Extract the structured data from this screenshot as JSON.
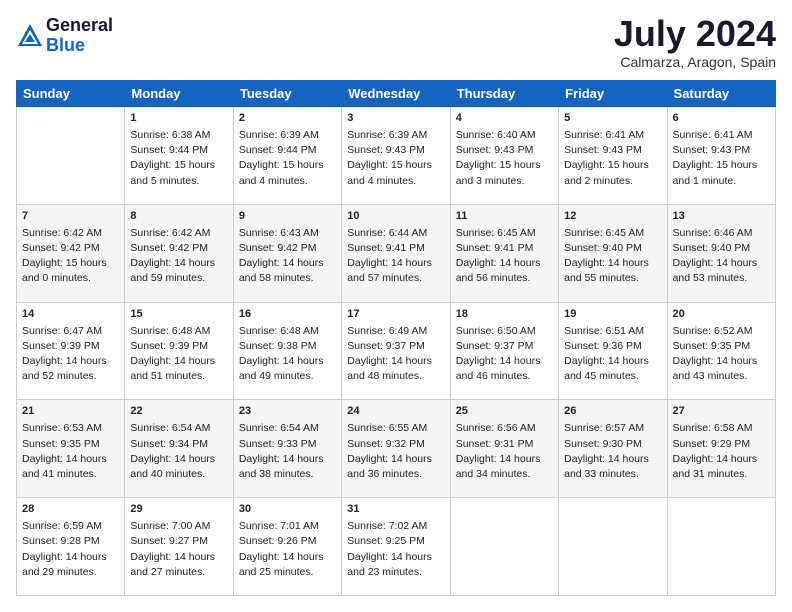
{
  "header": {
    "logo_general": "General",
    "logo_blue": "Blue",
    "month_title": "July 2024",
    "location": "Calmarza, Aragon, Spain"
  },
  "weekdays": [
    "Sunday",
    "Monday",
    "Tuesday",
    "Wednesday",
    "Thursday",
    "Friday",
    "Saturday"
  ],
  "weeks": [
    [
      {
        "day": "",
        "sunrise": "",
        "sunset": "",
        "daylight": ""
      },
      {
        "day": "1",
        "sunrise": "Sunrise: 6:38 AM",
        "sunset": "Sunset: 9:44 PM",
        "daylight": "Daylight: 15 hours and 5 minutes."
      },
      {
        "day": "2",
        "sunrise": "Sunrise: 6:39 AM",
        "sunset": "Sunset: 9:44 PM",
        "daylight": "Daylight: 15 hours and 4 minutes."
      },
      {
        "day": "3",
        "sunrise": "Sunrise: 6:39 AM",
        "sunset": "Sunset: 9:43 PM",
        "daylight": "Daylight: 15 hours and 4 minutes."
      },
      {
        "day": "4",
        "sunrise": "Sunrise: 6:40 AM",
        "sunset": "Sunset: 9:43 PM",
        "daylight": "Daylight: 15 hours and 3 minutes."
      },
      {
        "day": "5",
        "sunrise": "Sunrise: 6:41 AM",
        "sunset": "Sunset: 9:43 PM",
        "daylight": "Daylight: 15 hours and 2 minutes."
      },
      {
        "day": "6",
        "sunrise": "Sunrise: 6:41 AM",
        "sunset": "Sunset: 9:43 PM",
        "daylight": "Daylight: 15 hours and 1 minute."
      }
    ],
    [
      {
        "day": "7",
        "sunrise": "Sunrise: 6:42 AM",
        "sunset": "Sunset: 9:42 PM",
        "daylight": "Daylight: 15 hours and 0 minutes."
      },
      {
        "day": "8",
        "sunrise": "Sunrise: 6:42 AM",
        "sunset": "Sunset: 9:42 PM",
        "daylight": "Daylight: 14 hours and 59 minutes."
      },
      {
        "day": "9",
        "sunrise": "Sunrise: 6:43 AM",
        "sunset": "Sunset: 9:42 PM",
        "daylight": "Daylight: 14 hours and 58 minutes."
      },
      {
        "day": "10",
        "sunrise": "Sunrise: 6:44 AM",
        "sunset": "Sunset: 9:41 PM",
        "daylight": "Daylight: 14 hours and 57 minutes."
      },
      {
        "day": "11",
        "sunrise": "Sunrise: 6:45 AM",
        "sunset": "Sunset: 9:41 PM",
        "daylight": "Daylight: 14 hours and 56 minutes."
      },
      {
        "day": "12",
        "sunrise": "Sunrise: 6:45 AM",
        "sunset": "Sunset: 9:40 PM",
        "daylight": "Daylight: 14 hours and 55 minutes."
      },
      {
        "day": "13",
        "sunrise": "Sunrise: 6:46 AM",
        "sunset": "Sunset: 9:40 PM",
        "daylight": "Daylight: 14 hours and 53 minutes."
      }
    ],
    [
      {
        "day": "14",
        "sunrise": "Sunrise: 6:47 AM",
        "sunset": "Sunset: 9:39 PM",
        "daylight": "Daylight: 14 hours and 52 minutes."
      },
      {
        "day": "15",
        "sunrise": "Sunrise: 6:48 AM",
        "sunset": "Sunset: 9:39 PM",
        "daylight": "Daylight: 14 hours and 51 minutes."
      },
      {
        "day": "16",
        "sunrise": "Sunrise: 6:48 AM",
        "sunset": "Sunset: 9:38 PM",
        "daylight": "Daylight: 14 hours and 49 minutes."
      },
      {
        "day": "17",
        "sunrise": "Sunrise: 6:49 AM",
        "sunset": "Sunset: 9:37 PM",
        "daylight": "Daylight: 14 hours and 48 minutes."
      },
      {
        "day": "18",
        "sunrise": "Sunrise: 6:50 AM",
        "sunset": "Sunset: 9:37 PM",
        "daylight": "Daylight: 14 hours and 46 minutes."
      },
      {
        "day": "19",
        "sunrise": "Sunrise: 6:51 AM",
        "sunset": "Sunset: 9:36 PM",
        "daylight": "Daylight: 14 hours and 45 minutes."
      },
      {
        "day": "20",
        "sunrise": "Sunrise: 6:52 AM",
        "sunset": "Sunset: 9:35 PM",
        "daylight": "Daylight: 14 hours and 43 minutes."
      }
    ],
    [
      {
        "day": "21",
        "sunrise": "Sunrise: 6:53 AM",
        "sunset": "Sunset: 9:35 PM",
        "daylight": "Daylight: 14 hours and 41 minutes."
      },
      {
        "day": "22",
        "sunrise": "Sunrise: 6:54 AM",
        "sunset": "Sunset: 9:34 PM",
        "daylight": "Daylight: 14 hours and 40 minutes."
      },
      {
        "day": "23",
        "sunrise": "Sunrise: 6:54 AM",
        "sunset": "Sunset: 9:33 PM",
        "daylight": "Daylight: 14 hours and 38 minutes."
      },
      {
        "day": "24",
        "sunrise": "Sunrise: 6:55 AM",
        "sunset": "Sunset: 9:32 PM",
        "daylight": "Daylight: 14 hours and 36 minutes."
      },
      {
        "day": "25",
        "sunrise": "Sunrise: 6:56 AM",
        "sunset": "Sunset: 9:31 PM",
        "daylight": "Daylight: 14 hours and 34 minutes."
      },
      {
        "day": "26",
        "sunrise": "Sunrise: 6:57 AM",
        "sunset": "Sunset: 9:30 PM",
        "daylight": "Daylight: 14 hours and 33 minutes."
      },
      {
        "day": "27",
        "sunrise": "Sunrise: 6:58 AM",
        "sunset": "Sunset: 9:29 PM",
        "daylight": "Daylight: 14 hours and 31 minutes."
      }
    ],
    [
      {
        "day": "28",
        "sunrise": "Sunrise: 6:59 AM",
        "sunset": "Sunset: 9:28 PM",
        "daylight": "Daylight: 14 hours and 29 minutes."
      },
      {
        "day": "29",
        "sunrise": "Sunrise: 7:00 AM",
        "sunset": "Sunset: 9:27 PM",
        "daylight": "Daylight: 14 hours and 27 minutes."
      },
      {
        "day": "30",
        "sunrise": "Sunrise: 7:01 AM",
        "sunset": "Sunset: 9:26 PM",
        "daylight": "Daylight: 14 hours and 25 minutes."
      },
      {
        "day": "31",
        "sunrise": "Sunrise: 7:02 AM",
        "sunset": "Sunset: 9:25 PM",
        "daylight": "Daylight: 14 hours and 23 minutes."
      },
      {
        "day": "",
        "sunrise": "",
        "sunset": "",
        "daylight": ""
      },
      {
        "day": "",
        "sunrise": "",
        "sunset": "",
        "daylight": ""
      },
      {
        "day": "",
        "sunrise": "",
        "sunset": "",
        "daylight": ""
      }
    ]
  ]
}
